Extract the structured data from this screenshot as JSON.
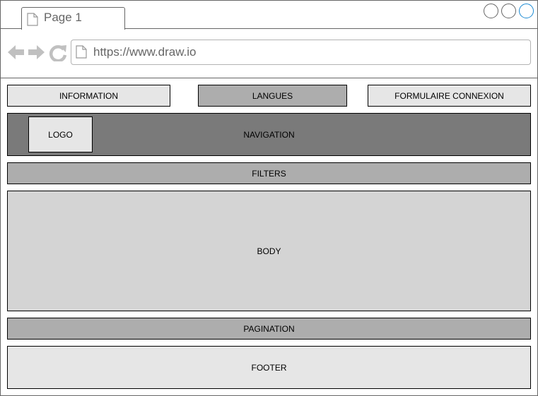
{
  "browser": {
    "tab_label": "Page 1",
    "url": "https://www.draw.io"
  },
  "header": {
    "information": "INFORMATION",
    "langues": "LANGUES",
    "formulaire": "FORMULAIRE CONNEXION"
  },
  "navigation": {
    "logo": "LOGO",
    "label": "NAVIGATION"
  },
  "filters": "FILTERS",
  "body": "BODY",
  "pagination": "PAGINATION",
  "footer": "FOOTER",
  "colors": {
    "light_box": "#e6e6e6",
    "mid_box": "#adadad",
    "dark_box": "#7a7a7a",
    "body_box": "#d4d4d4",
    "active_window_button": "#1b8ad3"
  }
}
